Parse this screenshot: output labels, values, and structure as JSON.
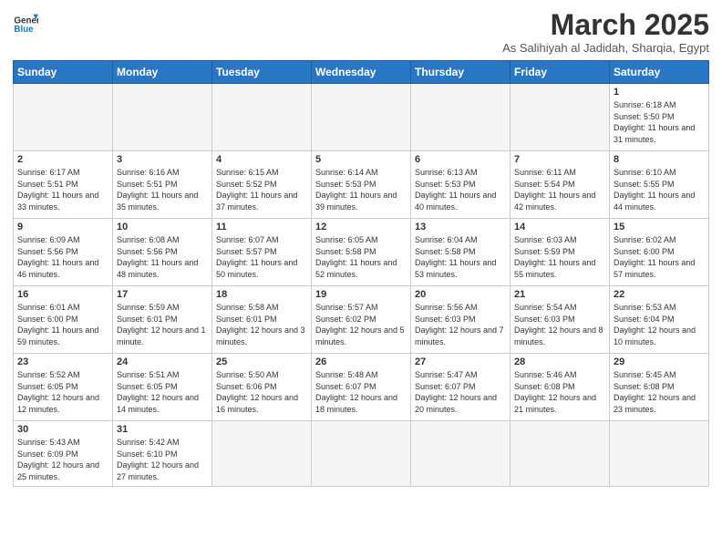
{
  "logo": {
    "general": "General",
    "blue": "Blue"
  },
  "header": {
    "month": "March 2025",
    "location": "As Salihiyah al Jadidah, Sharqia, Egypt"
  },
  "weekdays": [
    "Sunday",
    "Monday",
    "Tuesday",
    "Wednesday",
    "Thursday",
    "Friday",
    "Saturday"
  ],
  "days": [
    {
      "num": "",
      "info": ""
    },
    {
      "num": "",
      "info": ""
    },
    {
      "num": "",
      "info": ""
    },
    {
      "num": "",
      "info": ""
    },
    {
      "num": "",
      "info": ""
    },
    {
      "num": "",
      "info": ""
    },
    {
      "num": "1",
      "info": "Sunrise: 6:18 AM\nSunset: 5:50 PM\nDaylight: 11 hours and 31 minutes."
    }
  ],
  "week2": [
    {
      "num": "2",
      "info": "Sunrise: 6:17 AM\nSunset: 5:51 PM\nDaylight: 11 hours and 33 minutes."
    },
    {
      "num": "3",
      "info": "Sunrise: 6:16 AM\nSunset: 5:51 PM\nDaylight: 11 hours and 35 minutes."
    },
    {
      "num": "4",
      "info": "Sunrise: 6:15 AM\nSunset: 5:52 PM\nDaylight: 11 hours and 37 minutes."
    },
    {
      "num": "5",
      "info": "Sunrise: 6:14 AM\nSunset: 5:53 PM\nDaylight: 11 hours and 39 minutes."
    },
    {
      "num": "6",
      "info": "Sunrise: 6:13 AM\nSunset: 5:53 PM\nDaylight: 11 hours and 40 minutes."
    },
    {
      "num": "7",
      "info": "Sunrise: 6:11 AM\nSunset: 5:54 PM\nDaylight: 11 hours and 42 minutes."
    },
    {
      "num": "8",
      "info": "Sunrise: 6:10 AM\nSunset: 5:55 PM\nDaylight: 11 hours and 44 minutes."
    }
  ],
  "week3": [
    {
      "num": "9",
      "info": "Sunrise: 6:09 AM\nSunset: 5:56 PM\nDaylight: 11 hours and 46 minutes."
    },
    {
      "num": "10",
      "info": "Sunrise: 6:08 AM\nSunset: 5:56 PM\nDaylight: 11 hours and 48 minutes."
    },
    {
      "num": "11",
      "info": "Sunrise: 6:07 AM\nSunset: 5:57 PM\nDaylight: 11 hours and 50 minutes."
    },
    {
      "num": "12",
      "info": "Sunrise: 6:05 AM\nSunset: 5:58 PM\nDaylight: 11 hours and 52 minutes."
    },
    {
      "num": "13",
      "info": "Sunrise: 6:04 AM\nSunset: 5:58 PM\nDaylight: 11 hours and 53 minutes."
    },
    {
      "num": "14",
      "info": "Sunrise: 6:03 AM\nSunset: 5:59 PM\nDaylight: 11 hours and 55 minutes."
    },
    {
      "num": "15",
      "info": "Sunrise: 6:02 AM\nSunset: 6:00 PM\nDaylight: 11 hours and 57 minutes."
    }
  ],
  "week4": [
    {
      "num": "16",
      "info": "Sunrise: 6:01 AM\nSunset: 6:00 PM\nDaylight: 11 hours and 59 minutes."
    },
    {
      "num": "17",
      "info": "Sunrise: 5:59 AM\nSunset: 6:01 PM\nDaylight: 12 hours and 1 minute."
    },
    {
      "num": "18",
      "info": "Sunrise: 5:58 AM\nSunset: 6:01 PM\nDaylight: 12 hours and 3 minutes."
    },
    {
      "num": "19",
      "info": "Sunrise: 5:57 AM\nSunset: 6:02 PM\nDaylight: 12 hours and 5 minutes."
    },
    {
      "num": "20",
      "info": "Sunrise: 5:56 AM\nSunset: 6:03 PM\nDaylight: 12 hours and 7 minutes."
    },
    {
      "num": "21",
      "info": "Sunrise: 5:54 AM\nSunset: 6:03 PM\nDaylight: 12 hours and 8 minutes."
    },
    {
      "num": "22",
      "info": "Sunrise: 5:53 AM\nSunset: 6:04 PM\nDaylight: 12 hours and 10 minutes."
    }
  ],
  "week5": [
    {
      "num": "23",
      "info": "Sunrise: 5:52 AM\nSunset: 6:05 PM\nDaylight: 12 hours and 12 minutes."
    },
    {
      "num": "24",
      "info": "Sunrise: 5:51 AM\nSunset: 6:05 PM\nDaylight: 12 hours and 14 minutes."
    },
    {
      "num": "25",
      "info": "Sunrise: 5:50 AM\nSunset: 6:06 PM\nDaylight: 12 hours and 16 minutes."
    },
    {
      "num": "26",
      "info": "Sunrise: 5:48 AM\nSunset: 6:07 PM\nDaylight: 12 hours and 18 minutes."
    },
    {
      "num": "27",
      "info": "Sunrise: 5:47 AM\nSunset: 6:07 PM\nDaylight: 12 hours and 20 minutes."
    },
    {
      "num": "28",
      "info": "Sunrise: 5:46 AM\nSunset: 6:08 PM\nDaylight: 12 hours and 21 minutes."
    },
    {
      "num": "29",
      "info": "Sunrise: 5:45 AM\nSunset: 6:08 PM\nDaylight: 12 hours and 23 minutes."
    }
  ],
  "week6": [
    {
      "num": "30",
      "info": "Sunrise: 5:43 AM\nSunset: 6:09 PM\nDaylight: 12 hours and 25 minutes."
    },
    {
      "num": "31",
      "info": "Sunrise: 5:42 AM\nSunset: 6:10 PM\nDaylight: 12 hours and 27 minutes."
    },
    {
      "num": "",
      "info": ""
    },
    {
      "num": "",
      "info": ""
    },
    {
      "num": "",
      "info": ""
    },
    {
      "num": "",
      "info": ""
    },
    {
      "num": "",
      "info": ""
    }
  ]
}
